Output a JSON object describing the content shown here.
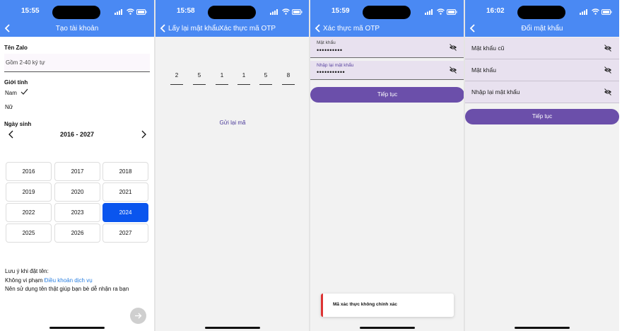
{
  "status_times": [
    "15:55",
    "15:58",
    "15:59",
    "16:02"
  ],
  "screen1": {
    "title": "Tạo tài khoản",
    "name_label": "Tên Zalo",
    "name_placeholder": "Gồm 2-40 ký tự",
    "gender_label": "Giới tính",
    "gender_options": [
      "Nam",
      "Nữ"
    ],
    "gender_selected": "Nam",
    "birth_label": "Ngày sinh",
    "year_range": "2016 - 2027",
    "years": [
      "2016",
      "2017",
      "2018",
      "2019",
      "2020",
      "2021",
      "2022",
      "2023",
      "2024",
      "2025",
      "2026",
      "2027"
    ],
    "year_selected": "2024",
    "note_title": "Lưu ý khi đặt tên:",
    "note_line1_prefix": "Không vi phạm",
    "note_line1_link": "Điều khoản dịch vụ",
    "note_line2": "Nên sử dụng tên thật giúp bạn bè dễ nhận ra bạn"
  },
  "screen2": {
    "back_label": "Lấy lại mật khẩu",
    "title": "Xác thực mã OTP",
    "otp_digits": [
      "2",
      "5",
      "1",
      "1",
      "5",
      "8"
    ],
    "resend_label": "Gửi lại mã"
  },
  "screen3": {
    "back_label": "Xác thực mã OTP",
    "password_label": "Mật khẩu",
    "password_value": "••••••••••",
    "confirm_label": "Nhập lại mật khẩu",
    "confirm_value": "•••••••••••",
    "continue_label": "Tiếp tục",
    "toast_text": "Mã xác thực không chính xác"
  },
  "screen4": {
    "title": "Đổi mật khẩu",
    "fields": [
      "Mật khẩu cũ",
      "Mật khẩu",
      "Nhập lại mật khẩu"
    ],
    "continue_label": "Tiếp tục"
  },
  "colors": {
    "header": "#4a89f3",
    "selected_year": "#0a55ee",
    "button": "#6b4faa",
    "link": "#2a7fe0",
    "error": "#dd3333"
  }
}
